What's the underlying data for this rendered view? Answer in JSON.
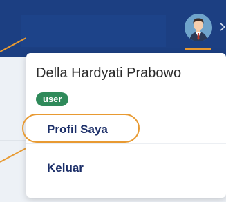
{
  "header": {
    "avatar_icon": "user-avatar-icon",
    "chevron_icon": "chevron-right-icon"
  },
  "user_menu": {
    "name": "Della Hardyati Prabowo",
    "role_badge": "user",
    "items": [
      {
        "label": "Profil Saya",
        "highlighted": true
      },
      {
        "label": "Keluar",
        "highlighted": false
      }
    ]
  },
  "colors": {
    "topbar": "#1c3f82",
    "badge": "#2f8a5a",
    "highlight": "#e89a32",
    "menu_text": "#1b2e68"
  }
}
